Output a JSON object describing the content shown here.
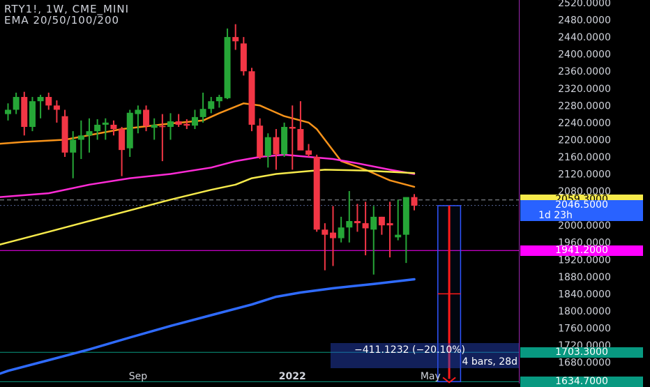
{
  "header": {
    "symbol_line": "RTY1!, 1W, CME_MINI",
    "indicator_line": "EMA 20/50/100/200"
  },
  "colors": {
    "background": "#000000",
    "up_candle": "#26a637",
    "down_candle": "#f23645",
    "ema20": "#f7931a",
    "ema50": "#ff2bd6",
    "ema100": "#f6ea4b",
    "ema200": "#2f6bff",
    "level_line": "#ff00ff",
    "measure_box": "#2f55ff",
    "measure_arrow": "#ff1a1a"
  },
  "chart_data": {
    "type": "candlestick",
    "ylim": [
      1630,
      2520
    ],
    "y_ticks": [
      "2520.0000",
      "2480.0000",
      "2440.0000",
      "2400.0000",
      "2360.0000",
      "2320.0000",
      "2280.0000",
      "2240.0000",
      "2200.0000",
      "2160.0000",
      "2120.0000",
      "2080.0000",
      "2040.0000",
      "2000.0000",
      "1960.0000",
      "1920.0000",
      "1880.0000",
      "1840.0000",
      "1800.0000",
      "1760.0000",
      "1720.0000",
      "1680.0000"
    ],
    "x_labels": [
      {
        "label": "Sep",
        "week": 16
      },
      {
        "label": "2022",
        "week": 35
      },
      {
        "label": "May",
        "week": 52
      }
    ],
    "candles": [
      {
        "o": 2260,
        "h": 2285,
        "l": 2245,
        "c": 2270
      },
      {
        "o": 2270,
        "h": 2310,
        "l": 2260,
        "c": 2300
      },
      {
        "o": 2300,
        "h": 2312,
        "l": 2210,
        "c": 2230
      },
      {
        "o": 2230,
        "h": 2300,
        "l": 2220,
        "c": 2290
      },
      {
        "o": 2290,
        "h": 2305,
        "l": 2250,
        "c": 2300
      },
      {
        "o": 2300,
        "h": 2310,
        "l": 2270,
        "c": 2280
      },
      {
        "o": 2280,
        "h": 2292,
        "l": 2240,
        "c": 2270
      },
      {
        "o": 2255,
        "h": 2270,
        "l": 2160,
        "c": 2170
      },
      {
        "o": 2170,
        "h": 2220,
        "l": 2110,
        "c": 2200
      },
      {
        "o": 2200,
        "h": 2245,
        "l": 2155,
        "c": 2210
      },
      {
        "o": 2210,
        "h": 2250,
        "l": 2170,
        "c": 2220
      },
      {
        "o": 2220,
        "h": 2248,
        "l": 2200,
        "c": 2235
      },
      {
        "o": 2235,
        "h": 2250,
        "l": 2200,
        "c": 2240
      },
      {
        "o": 2235,
        "h": 2245,
        "l": 2210,
        "c": 2225
      },
      {
        "o": 2225,
        "h": 2230,
        "l": 2115,
        "c": 2176
      },
      {
        "o": 2180,
        "h": 2270,
        "l": 2160,
        "c": 2263
      },
      {
        "o": 2260,
        "h": 2280,
        "l": 2215,
        "c": 2270
      },
      {
        "o": 2270,
        "h": 2280,
        "l": 2220,
        "c": 2232
      },
      {
        "o": 2228,
        "h": 2250,
        "l": 2200,
        "c": 2235
      },
      {
        "o": 2232,
        "h": 2260,
        "l": 2150,
        "c": 2230
      },
      {
        "o": 2230,
        "h": 2262,
        "l": 2200,
        "c": 2243
      },
      {
        "o": 2243,
        "h": 2260,
        "l": 2230,
        "c": 2235
      },
      {
        "o": 2237,
        "h": 2248,
        "l": 2225,
        "c": 2233
      },
      {
        "o": 2233,
        "h": 2270,
        "l": 2225,
        "c": 2253
      },
      {
        "o": 2253,
        "h": 2310,
        "l": 2240,
        "c": 2272
      },
      {
        "o": 2272,
        "h": 2300,
        "l": 2262,
        "c": 2290
      },
      {
        "o": 2290,
        "h": 2305,
        "l": 2275,
        "c": 2300
      },
      {
        "o": 2297,
        "h": 2460,
        "l": 2295,
        "c": 2440
      },
      {
        "o": 2440,
        "h": 2470,
        "l": 2410,
        "c": 2430
      },
      {
        "o": 2425,
        "h": 2440,
        "l": 2350,
        "c": 2360
      },
      {
        "o": 2360,
        "h": 2368,
        "l": 2220,
        "c": 2235
      },
      {
        "o": 2233,
        "h": 2250,
        "l": 2155,
        "c": 2160
      },
      {
        "o": 2162,
        "h": 2215,
        "l": 2135,
        "c": 2206
      },
      {
        "o": 2206,
        "h": 2225,
        "l": 2130,
        "c": 2166
      },
      {
        "o": 2166,
        "h": 2240,
        "l": 2160,
        "c": 2230
      },
      {
        "o": 2230,
        "h": 2280,
        "l": 2130,
        "c": 2226
      },
      {
        "o": 2225,
        "h": 2290,
        "l": 2185,
        "c": 2175
      },
      {
        "o": 2175,
        "h": 2190,
        "l": 2160,
        "c": 2165
      },
      {
        "o": 2160,
        "h": 2165,
        "l": 1985,
        "c": 1990
      },
      {
        "o": 1990,
        "h": 2005,
        "l": 1895,
        "c": 1978
      },
      {
        "o": 1983,
        "h": 2045,
        "l": 1905,
        "c": 1970
      },
      {
        "o": 1970,
        "h": 2020,
        "l": 1960,
        "c": 1995
      },
      {
        "o": 1995,
        "h": 2080,
        "l": 1960,
        "c": 2010
      },
      {
        "o": 2010,
        "h": 2050,
        "l": 1985,
        "c": 2005
      },
      {
        "o": 2005,
        "h": 2055,
        "l": 1930,
        "c": 1993
      },
      {
        "o": 1990,
        "h": 2045,
        "l": 1885,
        "c": 2020
      },
      {
        "o": 2020,
        "h": 2020,
        "l": 1978,
        "c": 2000
      },
      {
        "o": 2005,
        "h": 2055,
        "l": 1925,
        "c": 2000
      },
      {
        "o": 1972,
        "h": 2060,
        "l": 1965,
        "c": 1978
      },
      {
        "o": 1978,
        "h": 2065,
        "l": 1912,
        "c": 2066
      },
      {
        "o": 2066,
        "h": 2073,
        "l": 2035,
        "c": 2046
      }
    ],
    "series": [
      {
        "key": "ema20",
        "points": [
          [
            -5,
            2185
          ],
          [
            2,
            2195
          ],
          [
            7,
            2200
          ],
          [
            14,
            2225
          ],
          [
            20,
            2238
          ],
          [
            24,
            2245
          ],
          [
            26,
            2262
          ],
          [
            29,
            2285
          ],
          [
            31,
            2280
          ],
          [
            34,
            2255
          ],
          [
            37,
            2240
          ],
          [
            38,
            2225
          ],
          [
            41,
            2150
          ],
          [
            44,
            2130
          ],
          [
            47,
            2105
          ],
          [
            50,
            2090
          ]
        ]
      },
      {
        "key": "ema50",
        "points": [
          [
            -5,
            2060
          ],
          [
            5,
            2075
          ],
          [
            10,
            2095
          ],
          [
            15,
            2110
          ],
          [
            20,
            2120
          ],
          [
            25,
            2135
          ],
          [
            28,
            2150
          ],
          [
            31,
            2160
          ],
          [
            34,
            2165
          ],
          [
            37,
            2160
          ],
          [
            40,
            2155
          ],
          [
            43,
            2145
          ],
          [
            47,
            2130
          ],
          [
            50,
            2120
          ]
        ]
      },
      {
        "key": "ema100",
        "points": [
          [
            -5,
            1935
          ],
          [
            0,
            1960
          ],
          [
            5,
            1985
          ],
          [
            10,
            2010
          ],
          [
            15,
            2035
          ],
          [
            20,
            2060
          ],
          [
            25,
            2083
          ],
          [
            28,
            2095
          ],
          [
            30,
            2110
          ],
          [
            33,
            2120
          ],
          [
            36,
            2125
          ],
          [
            39,
            2130
          ],
          [
            44,
            2128
          ],
          [
            50,
            2122
          ]
        ]
      },
      {
        "key": "ema200",
        "points": [
          [
            -5,
            1627
          ],
          [
            0,
            1660
          ],
          [
            5,
            1685
          ],
          [
            10,
            1710
          ],
          [
            15,
            1738
          ],
          [
            20,
            1765
          ],
          [
            25,
            1790
          ],
          [
            30,
            1815
          ],
          [
            33,
            1833
          ],
          [
            36,
            1843
          ],
          [
            40,
            1853
          ],
          [
            45,
            1863
          ],
          [
            50,
            1874
          ]
        ]
      }
    ],
    "horizontal_levels": [
      {
        "value": 2059.3,
        "label": "2059.3000",
        "style": "dashed",
        "bg": "#f6ea4b",
        "fg": "#000000",
        "line": "#9aa0a6"
      },
      {
        "value": 2046.5,
        "label": "2046.5000",
        "extra": "1d 23h",
        "style": "dotted",
        "bg": "#2962ff",
        "fg": "#ffffff",
        "line": "#5a6a9a"
      },
      {
        "value": 1941.2,
        "label": "1941.2000",
        "style": "solid",
        "bg": "#ff00ff",
        "fg": "#ffffff",
        "line": "#ff00ff"
      },
      {
        "value": 1703.3,
        "label": "1703.3000",
        "style": "solid",
        "bg": "#089981",
        "fg": "#ffffff",
        "line": "#089981"
      },
      {
        "value": 1634.7,
        "label": "1634.7000",
        "style": "solid",
        "bg": "#089981",
        "fg": "#ffffff",
        "line": "#089981"
      }
    ],
    "measure": {
      "from": 2046.0,
      "to": 1634.7,
      "mid": 1840.0,
      "week_start": 52.9,
      "week_end": 55.7,
      "change_text": "−411.1232 (−20.10%)",
      "bars_text": "4 bars, 28d"
    }
  }
}
